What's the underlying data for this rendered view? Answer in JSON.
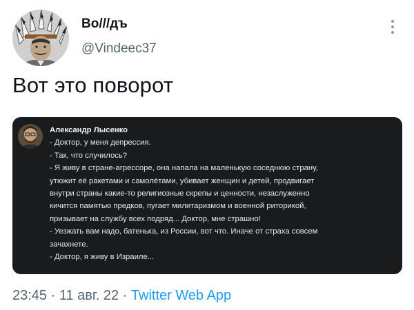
{
  "author": {
    "display_name": "Во///дъ",
    "handle": "@Vindeec37"
  },
  "tweet": {
    "text": "Вот это поворот"
  },
  "quoted_card": {
    "author_name": "Александр Лысенко",
    "lines": [
      "- Доктор, у меня депрессия.",
      "- Так, что случилось?",
      "- Я живу в стране-агрессоре, она напала на маленькую соседнюю страну,",
      "утюжит её ракетами и самолётами, убивает женщин и детей, продвигает",
      "внутри страны какие-то религиозные скрепы и ценности, незаслуженно",
      "кичится памятью предков, пугает милитаризмом и военной риторикой,",
      "призывает на службу всех подряд... Доктор, мне страшно!",
      "- Уезжать вам надо, батенька, из России, вот что. Иначе от страха совсем",
      "зачахнете.",
      "- Доктор, я живу в Израиле..."
    ]
  },
  "meta": {
    "time": "23:45",
    "separator1": " · ",
    "date": "11 авг. 22",
    "separator2": " · ",
    "source": "Twitter Web App"
  },
  "icons": {
    "more": "more-options-icon"
  }
}
